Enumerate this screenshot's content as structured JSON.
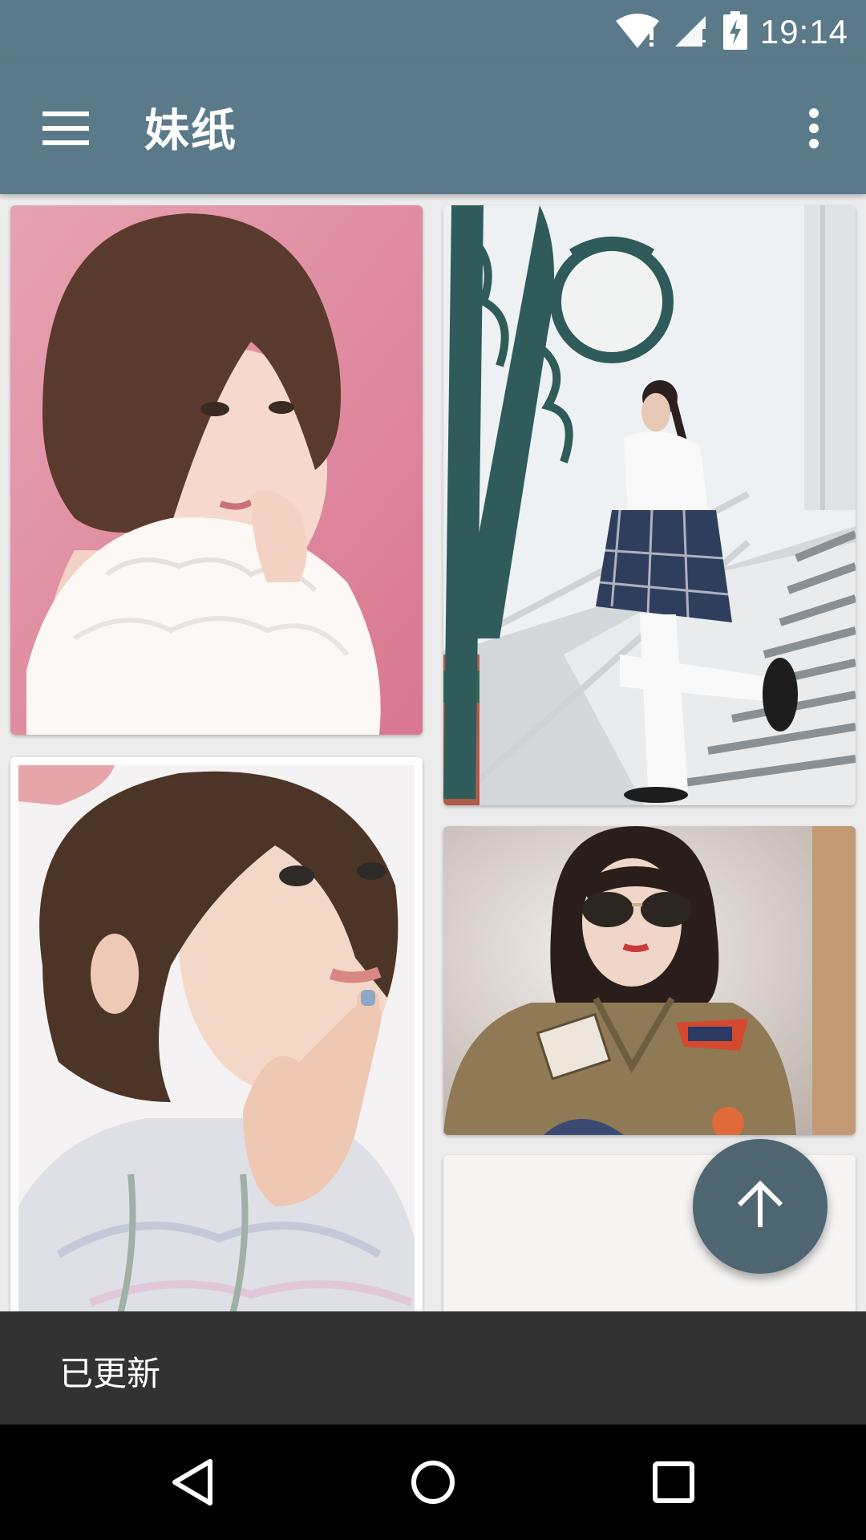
{
  "status_bar": {
    "time": "19:14",
    "icons": [
      "wifi-icon",
      "signal-icon",
      "battery-charging-icon"
    ]
  },
  "app_bar": {
    "title": "妹纸",
    "menu_icon": "hamburger-menu-icon",
    "overflow_icon": "more-vert-icon"
  },
  "grid": {
    "photos": [
      {
        "name": "photo-short-bob-pink-background"
      },
      {
        "name": "photo-girl-on-stairs-lamp-post"
      },
      {
        "name": "photo-short-hair-finger-on-chin"
      },
      {
        "name": "photo-girl-aviator-sunglasses-uniform"
      },
      {
        "name": "photo-loading-placeholder"
      }
    ]
  },
  "snackbar": {
    "message": "已更新"
  },
  "fab": {
    "icon": "arrow-up-icon"
  },
  "nav_bar": {
    "buttons": [
      "back-icon",
      "home-icon",
      "recents-icon"
    ]
  },
  "colors": {
    "primary": "#5b7a89",
    "fab": "#4e6572",
    "snackbar": "#323232",
    "background": "#ececec"
  }
}
